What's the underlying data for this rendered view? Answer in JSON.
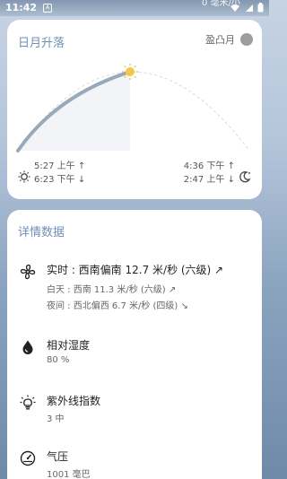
{
  "status_bar": {
    "time": "11:42",
    "peek_text": "0 毫米/小"
  },
  "sun_card": {
    "title": "日月升落",
    "moon_phase": "盈凸月",
    "sunrise": "5:27 上午 ↑",
    "sunset": "6:23 下午 ↓",
    "moonrise": "4:36 下午 ↑",
    "moonset": "2:47 上午 ↓"
  },
  "detail_card": {
    "title": "详情数据",
    "wind": {
      "title": "实时 : 西南偏南 12.7 米/秒 (六级) ↗",
      "day": "白天 : 西南 11.3 米/秒 (六级) ↗",
      "night": "夜间 : 西北偏西 6.7 米/秒 (四级) ↘"
    },
    "humidity": {
      "title": "相对湿度",
      "value": "80 %"
    },
    "uv": {
      "title": "紫外线指数",
      "value": "3 中"
    },
    "pressure": {
      "title": "气压",
      "value": "1001 毫巴"
    }
  },
  "colors": {
    "accent": "#6f8fb5",
    "arc_done": "#9aa9ba",
    "sun_dot": "#f2c84b"
  }
}
